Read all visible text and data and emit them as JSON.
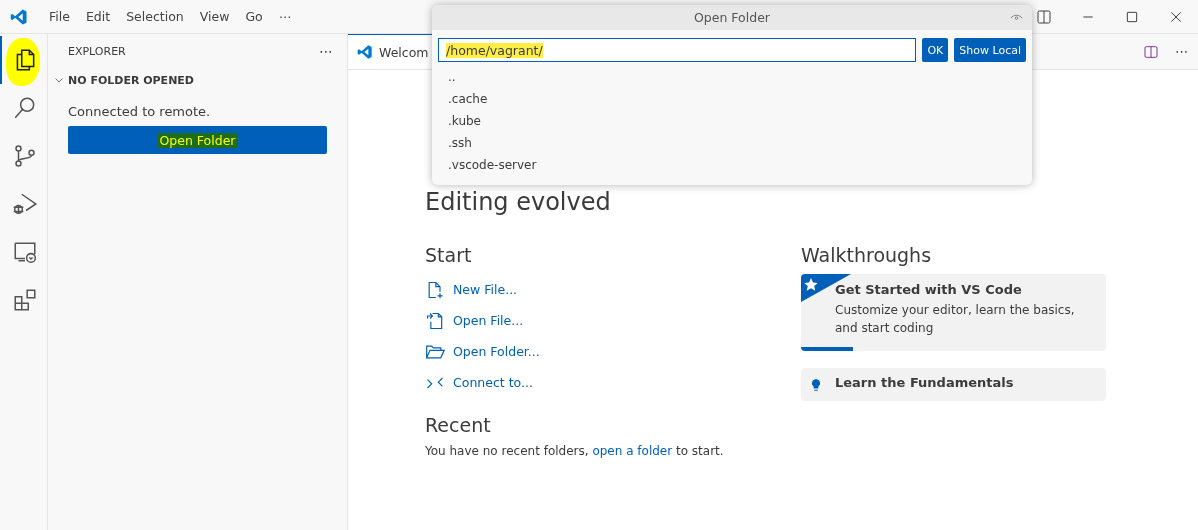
{
  "menu": [
    "File",
    "Edit",
    "Selection",
    "View",
    "Go",
    "⋯"
  ],
  "activity_bar": [
    {
      "kind": "files",
      "selected": true,
      "highlighted": true
    },
    {
      "kind": "search",
      "selected": false
    },
    {
      "kind": "source-control",
      "selected": false
    },
    {
      "kind": "run",
      "selected": false
    },
    {
      "kind": "remote",
      "selected": false
    },
    {
      "kind": "extensions",
      "selected": false
    }
  ],
  "sidebar": {
    "title": "EXPLORER",
    "more": "⋯",
    "section": {
      "title": "NO FOLDER OPENED",
      "expanded": true
    },
    "message": "Connected to remote.",
    "button": {
      "label": "Open Folder",
      "highlighted": true
    }
  },
  "tabs": [
    {
      "label": "Welcom",
      "selected": true
    }
  ],
  "editor_actions": [
    "⋯"
  ],
  "welcome": {
    "subtitle": "Editing evolved",
    "start": {
      "title": "Start",
      "items": [
        {
          "kind": "new-file",
          "label": "New File..."
        },
        {
          "kind": "open-file",
          "label": "Open File..."
        },
        {
          "kind": "open-folder",
          "label": "Open Folder..."
        },
        {
          "kind": "connect",
          "label": "Connect to..."
        }
      ]
    },
    "recent": {
      "title": "Recent",
      "before": "You have no recent folders,",
      "link": "open a folder",
      "after": "to start."
    },
    "walkthroughs": {
      "title": "Walkthroughs",
      "items": [
        {
          "kind": "featured",
          "title": "Get Started with VS Code",
          "description": "Customize your editor, learn the basics, and start coding",
          "level": 0.17
        },
        {
          "kind": "plain",
          "title": "Learn the Fundamentals"
        }
      ]
    }
  },
  "dialog": {
    "title": "Open Folder",
    "input": {
      "value": "/home/vagrant/",
      "highlighted": true
    },
    "buttons": [
      "OK",
      "Show Local"
    ],
    "items": [
      "..",
      ".cache",
      ".kube",
      ".ssh",
      ".vscode-server"
    ]
  }
}
